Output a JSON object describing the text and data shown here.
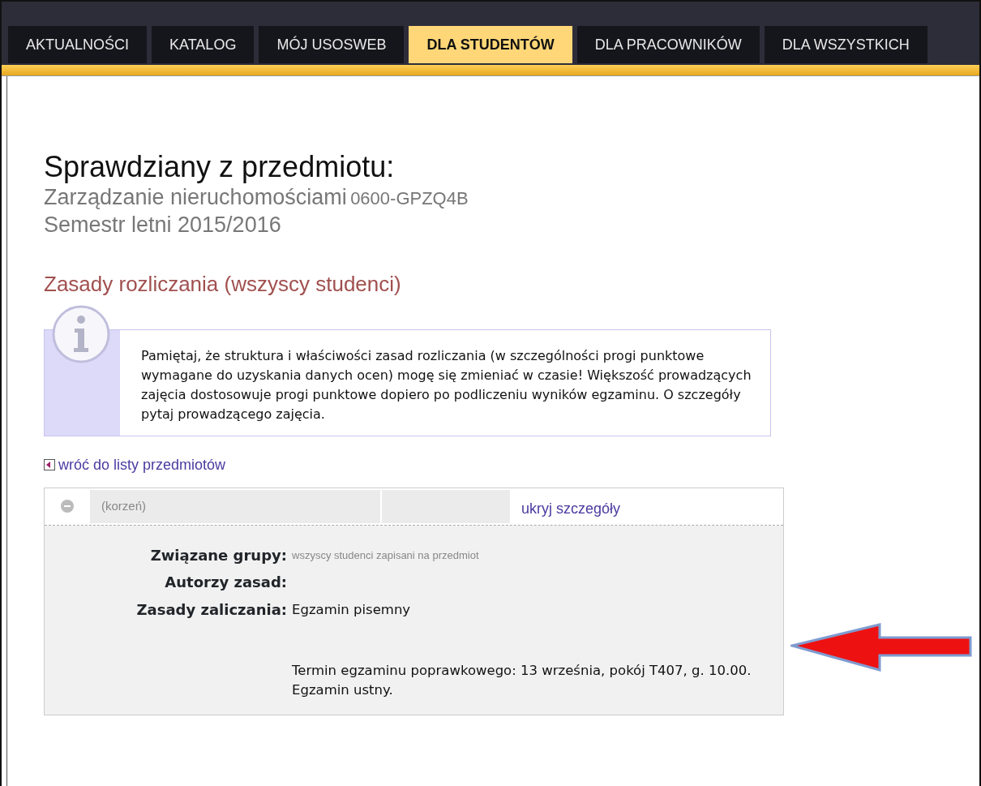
{
  "tabs": [
    {
      "label": "AKTUALNOŚCI",
      "selected": false
    },
    {
      "label": "KATALOG",
      "selected": false
    },
    {
      "label": "MÓJ USOSWEB",
      "selected": false
    },
    {
      "label": "DLA STUDENTÓW",
      "selected": true
    },
    {
      "label": "DLA PRACOWNIKÓW",
      "selected": false
    },
    {
      "label": "DLA WSZYSTKICH",
      "selected": false
    }
  ],
  "page": {
    "title": "Sprawdziany z przedmiotu:",
    "course_name": "Zarządzanie nieruchomościami",
    "course_code": "0600-GPZQ4B",
    "semester": "Semestr letni 2015/2016"
  },
  "section_heading": "Zasady rozliczania (wszyscy studenci)",
  "info_box": {
    "text": "Pamiętaj, że struktura i właściwości zasad rozliczania (w szczególności progi punktowe wymagane do uzyskania danych ocen) mogę się zmieniać w czasie! Większość prowadzących zajęcia dostosowuje progi punktowe dopiero po podliczeniu wyników egzaminu. O szczegóły pytaj prowadzącego zajęcia."
  },
  "back_link": "wróć do listy przedmiotów",
  "tree": {
    "node": "(korzeń)",
    "expanded": true,
    "toggle_link": "ukryj szczegóły",
    "details": [
      {
        "label": "Związane grupy:",
        "kind": "small",
        "lines": [
          "wszyscy studenci zapisani na przedmiot"
        ]
      },
      {
        "label": "Autorzy zasad:",
        "kind": "normal"
      },
      {
        "label": "Zasady zaliczania:",
        "kind": "normal",
        "lines": [
          "Egzamin pisemny",
          "Termin egzaminu poprawkowego: 13 września, pokój T407, g. 10.00. Egzamin ustny."
        ]
      }
    ]
  }
}
